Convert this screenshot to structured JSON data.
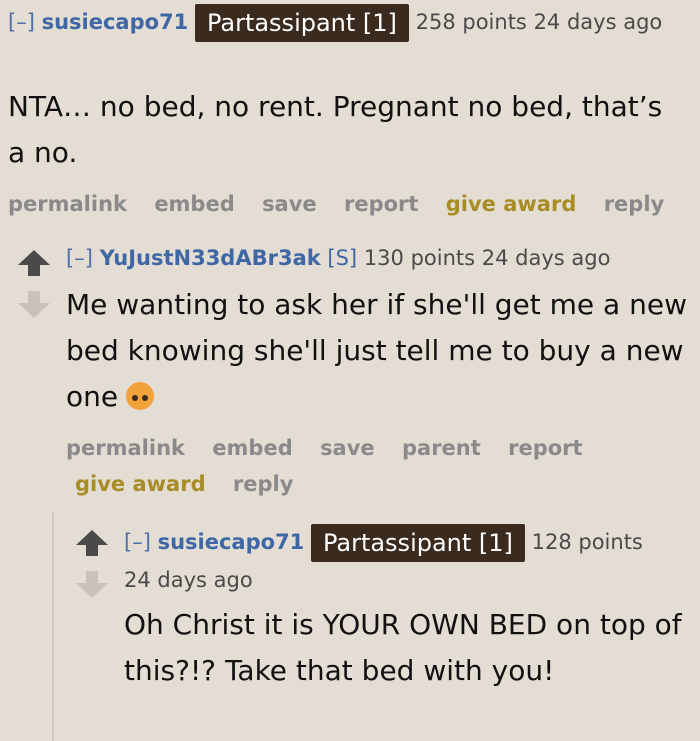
{
  "comments": [
    {
      "toggle": "[–]",
      "author": "susiecapo71",
      "flair": "Partassipant [1]",
      "points": "258 points",
      "time": "24 days ago",
      "body": "NTA… no bed, no rent. Pregnant no bed, that’s a no.",
      "actions": [
        "permalink",
        "embed",
        "save",
        "report",
        "give award",
        "reply"
      ]
    },
    {
      "toggle": "[–]",
      "author": "YuJustN33dABr3ak",
      "submitter": "[S]",
      "points": "130 points",
      "time": "24 days ago",
      "body": "Me wanting to ask her if she'll get me a new bed knowing she'll just tell me to buy a new one",
      "emoji": "flushed-face-emoji",
      "actions": [
        "permalink",
        "embed",
        "save",
        "parent",
        "report",
        "give award",
        "reply"
      ]
    },
    {
      "toggle": "[–]",
      "author": "susiecapo71",
      "flair": "Partassipant [1]",
      "points": "128 points",
      "time": "24 days ago",
      "body": "Oh Christ it is YOUR OWN BED on top of this?!? Take that bed with you!"
    }
  ],
  "colors": {
    "background": "#e3ddd4",
    "author": "#3f67a5",
    "flair_bg": "#3b2a1e",
    "award": "#a88c26",
    "action": "#8a8a8a"
  }
}
